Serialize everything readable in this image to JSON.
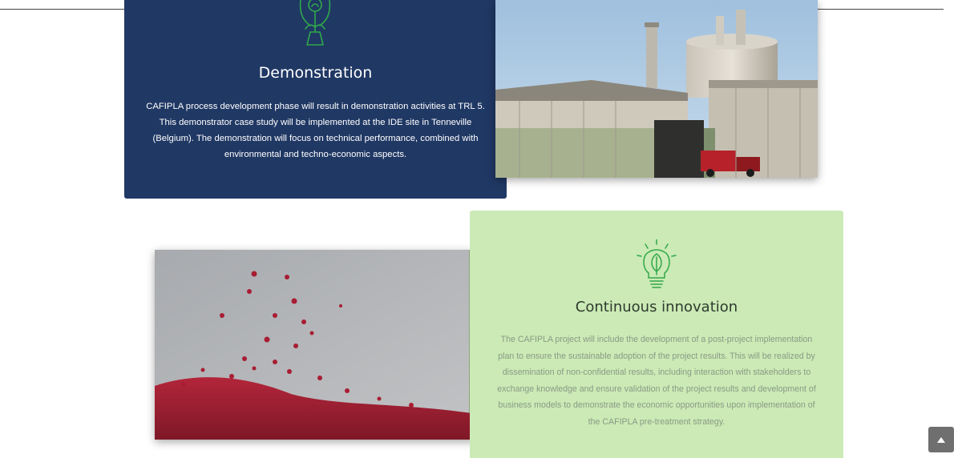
{
  "demonstration": {
    "title": "Demonstration",
    "body": "CAFIPLA process development phase will result in demonstration activities at TRL 5. This demonstrator case study will be implemented at the IDE site in Tenneville (Belgium). The demonstration will focus on technical performance, combined with environmental and techno-economic aspects.",
    "icon": "hands-plant-icon"
  },
  "innovation": {
    "title": "Continuous innovation",
    "body": "The CAFIPLA project will include the development of a post-project implementation plan to ensure the sustainable adoption of the project results. This will be realized by dissemination of non-confidential results, including interaction with stakeholders to exchange knowledge and ensure validation of the project results and development of business models to demonstrate the economic opportunities upon implementation of the CAFIPLA pre-treatment strategy.",
    "icon": "lightbulb-leaf-icon"
  },
  "images": {
    "factory": "industrial-plant-photo",
    "granules": "red-granules-photo"
  },
  "scroll_top": {
    "icon": "chevron-up-icon"
  },
  "colors": {
    "demo_bg": "#203864",
    "innov_bg": "#cbeab5",
    "icon_green": "#2fa84a"
  }
}
